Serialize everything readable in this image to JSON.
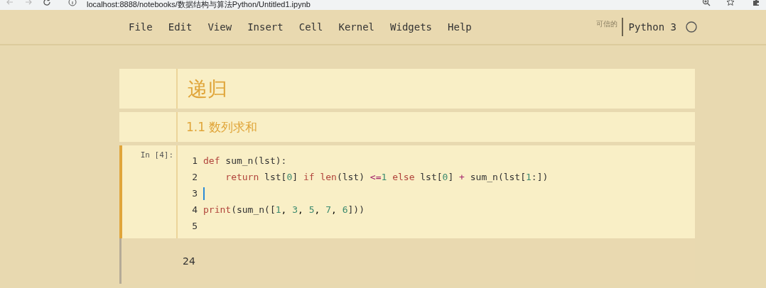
{
  "browser": {
    "url": "localhost:8888/notebooks/数据结构与算法Python/Untitled1.ipynb"
  },
  "menu": {
    "items": [
      "File",
      "Edit",
      "View",
      "Insert",
      "Cell",
      "Kernel",
      "Widgets",
      "Help"
    ],
    "trusted": "可信的",
    "kernel": "Python 3",
    "kernel_busy": false
  },
  "cells": [
    {
      "kind": "title",
      "text": "递归"
    },
    {
      "kind": "subtitle",
      "text": "1.1 数列求和"
    },
    {
      "kind": "code",
      "prompt": "In [4]:",
      "selected": true,
      "lines": [
        {
          "number": "1",
          "cursor": false,
          "tokens": [
            {
              "text": "def",
              "color": "#b0433b"
            },
            {
              "text": " sum_n(lst):",
              "color": "#333333"
            }
          ]
        },
        {
          "number": "2",
          "cursor": false,
          "tokens": [
            {
              "text": "    return",
              "color": "#b0433b"
            },
            {
              "text": " lst[",
              "color": "#333333"
            },
            {
              "text": "0",
              "color": "#3b8a6e"
            },
            {
              "text": "] ",
              "color": "#333333"
            },
            {
              "text": "if",
              "color": "#b0433b"
            },
            {
              "text": " len",
              "color": "#b0433b"
            },
            {
              "text": "(lst) ",
              "color": "#333333"
            },
            {
              "text": "<=",
              "color": "#a2216a"
            },
            {
              "text": "1",
              "color": "#3b8a6e"
            },
            {
              "text": " else",
              "color": "#b0433b"
            },
            {
              "text": " lst[",
              "color": "#333333"
            },
            {
              "text": "0",
              "color": "#3b8a6e"
            },
            {
              "text": "] ",
              "color": "#333333"
            },
            {
              "text": "+",
              "color": "#a2216a"
            },
            {
              "text": " sum_n(lst[",
              "color": "#333333"
            },
            {
              "text": "1",
              "color": "#3b8a6e"
            },
            {
              "text": ":])",
              "color": "#333333"
            }
          ]
        },
        {
          "number": "3",
          "cursor": true
        },
        {
          "number": "4",
          "cursor": false,
          "tokens": [
            {
              "text": "print",
              "color": "#b0433b"
            },
            {
              "text": "(sum_n([",
              "color": "#333333"
            },
            {
              "text": "1",
              "color": "#3b8a6e"
            },
            {
              "text": ", "
            },
            {
              "text": "3",
              "color": "#3b8a6e"
            },
            {
              "text": ", "
            },
            {
              "text": "5",
              "color": "#3b8a6e"
            },
            {
              "text": ", "
            },
            {
              "text": "7",
              "color": "#3b8a6e"
            },
            {
              "text": ", "
            },
            {
              "text": "6",
              "color": "#3b8a6e"
            },
            {
              "text": "]))",
              "color": "#333333"
            }
          ]
        },
        {
          "number": "5",
          "cursor": false
        }
      ]
    },
    {
      "kind": "output",
      "text": "24"
    }
  ]
}
